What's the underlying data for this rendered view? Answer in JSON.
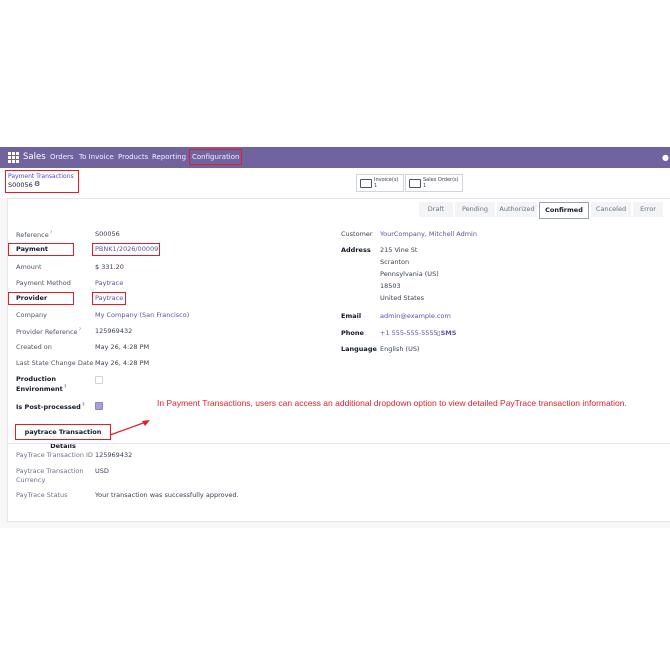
{
  "navbar": {
    "app": "Sales",
    "items": [
      "Orders",
      "To Invoice",
      "Products",
      "Reporting",
      "Configuration"
    ]
  },
  "breadcrumb": {
    "parent": "Payment Transactions",
    "record": "S00056"
  },
  "smart_buttons": [
    {
      "label": "Invoice(s)",
      "count": "1"
    },
    {
      "label": "Sales Order(s)",
      "count": "1"
    }
  ],
  "status_stages": [
    "Draft",
    "Pending",
    "Authorized",
    "Confirmed",
    "Canceled",
    "Error"
  ],
  "active_stage": "Confirmed",
  "left_fields": {
    "reference_label": "Reference",
    "reference": "S00056",
    "payment_label": "Payment",
    "payment": "PBNK1/2026/00009",
    "amount_label": "Amount",
    "amount": "$ 331.20",
    "method_label": "Payment Method",
    "method": "Paytrace",
    "provider_label": "Provider",
    "provider": "Paytrace",
    "company_label": "Company",
    "company": "My Company (San Francisco)",
    "provider_ref_label": "Provider Reference",
    "provider_ref": "125969432",
    "created_label": "Created on",
    "created": "May 26, 4:28 PM",
    "last_change_label": "Last State Change Date",
    "last_change": "May 26, 4:28 PM",
    "production_label_1": "Production",
    "production_label_2": "Environment",
    "postprocessed_label": "Is Post-processed"
  },
  "right_fields": {
    "customer_label": "Customer",
    "customer": "YourCompany, Mitchell Admin",
    "address_label": "Address",
    "address_lines": [
      "215 Vine St",
      "Scranton",
      "Pennsylvania (US)",
      "18503",
      "United States"
    ],
    "email_label": "Email",
    "email": "admin@example.com",
    "phone_label": "Phone",
    "phone": "+1 555-555-5555",
    "sms": "SMS",
    "language_label": "Language",
    "language": "English (US)"
  },
  "annotation": "In Payment Transactions, users can access an additional dropdown option to view detailed PayTrace transaction information.",
  "tab_label": "paytrace Transaction Details",
  "paytrace": {
    "id_label": "PayTrace Transaction ID",
    "id": "125969432",
    "currency_label_1": "Paytrace Transaction",
    "currency_label_2": "Currency",
    "currency": "USD",
    "status_label": "PayTrace Status",
    "status": "Your transaction was successfully approved."
  },
  "colors": {
    "navbar": "#71639e",
    "highlight": "#e11d2a",
    "link": "#5b4fa8"
  }
}
